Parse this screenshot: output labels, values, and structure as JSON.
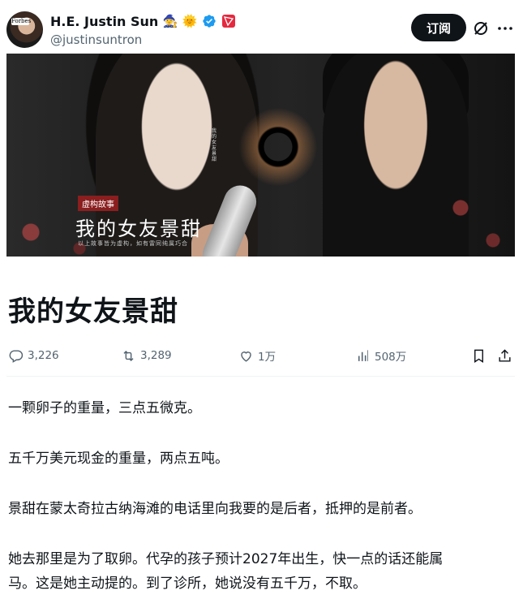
{
  "author": {
    "name": "H.E. Justin Sun",
    "handle": "@justinsuntron",
    "avatar_label": "Forbes",
    "badges": [
      "mage-emoji",
      "sun-emoji",
      "verified-icon",
      "tron-logo"
    ]
  },
  "header": {
    "subscribe_label": "订阅",
    "grok_icon": "grok-icon",
    "more_icon": "more-icon"
  },
  "cover": {
    "tag": "虚构故事",
    "title": "我的女友景甜",
    "subtitle": "以上故事皆为虚构，如有雷同纯属巧合",
    "vertical_text": "我的女友景甜"
  },
  "article": {
    "title": "我的女友景甜"
  },
  "actions": {
    "replies": "3,226",
    "reposts": "3,289",
    "likes": "1万",
    "views": "508万"
  },
  "paragraphs": [
    "一颗卵子的重量，三点五微克。",
    "五千万美元现金的重量，两点五吨。",
    "景甜在蒙太奇拉古纳海滩的电话里向我要的是后者，抵押的是前者。",
    "她去那里是为了取卵。代孕的孩子预计2027年出生，快一点的话还能属",
    "马。这是她主动提的。到了诊所，她说没有五千万，不取。"
  ],
  "colors": {
    "text": "#0f1419",
    "secondary": "#536471",
    "verified": "#1d9bf0",
    "button_bg": "#0f1419"
  }
}
